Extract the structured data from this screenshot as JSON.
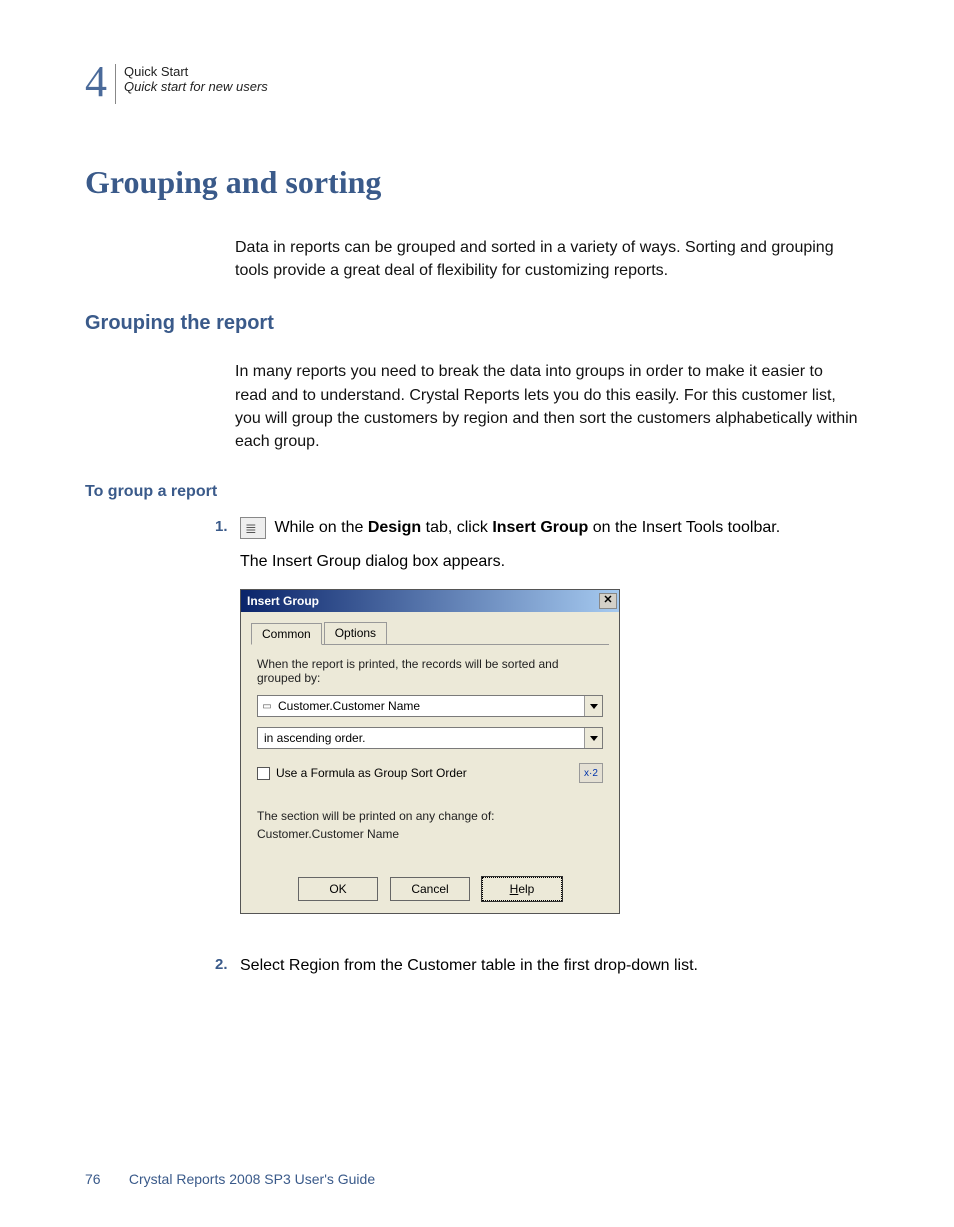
{
  "header": {
    "chapter_number": "4",
    "breadcrumb_top": "Quick Start",
    "breadcrumb_sub": "Quick start for new users"
  },
  "h1": "Grouping and sorting",
  "intro_para": "Data in reports can be grouped and sorted in a variety of ways. Sorting and grouping tools provide a great deal of flexibility for customizing reports.",
  "h2": "Grouping the report",
  "grouping_para": "In many reports you need to break the data into groups in order to make it easier to read and to understand. Crystal Reports lets you do this easily. For this customer list, you will group the customers by region and then sort the customers alphabetically within each group.",
  "h3": "To group a report",
  "steps": {
    "s1_num": "1.",
    "s1_pre_icon_space": "",
    "s1_text_a": " While on the ",
    "s1_bold_a": "Design",
    "s1_text_b": " tab, click ",
    "s1_bold_b": "Insert Group",
    "s1_text_c": " on the Insert Tools toolbar.",
    "s1_followup": "The Insert Group dialog box appears.",
    "s2_num": "2.",
    "s2_text": "Select Region from the Customer table in the first drop-down list."
  },
  "dialog": {
    "title": "Insert Group",
    "close_glyph": "✕",
    "tab_common": "Common",
    "tab_options": "Options",
    "instruction": "When the report is printed, the records will be sorted and grouped by:",
    "field_value": "Customer.Customer Name",
    "order_value": "in ascending order.",
    "checkbox_label": "Use a Formula as Group Sort Order",
    "formula_btn": "x·2",
    "section_line1": "The section will be printed on any change of:",
    "section_line2": "Customer.Customer Name",
    "btn_ok": "OK",
    "btn_cancel": "Cancel",
    "btn_help_pre": "",
    "btn_help_letter": "H",
    "btn_help_rest": "elp"
  },
  "footer": {
    "page_number": "76",
    "book_title": "Crystal Reports 2008 SP3 User's Guide"
  }
}
